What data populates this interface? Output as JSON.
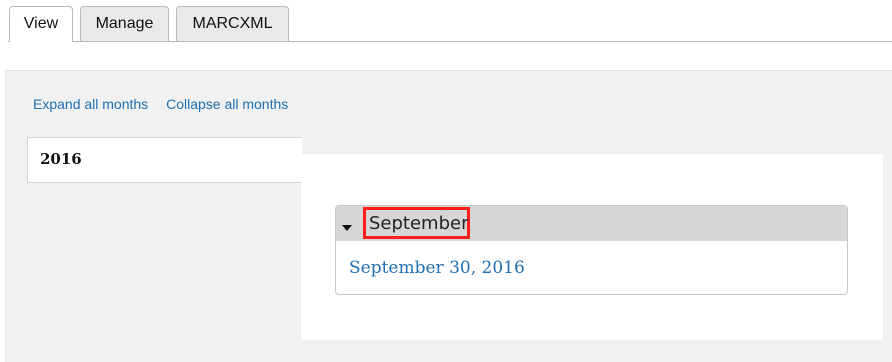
{
  "tabs": [
    {
      "label": "View",
      "active": true
    },
    {
      "label": "Manage",
      "active": false
    },
    {
      "label": "MARCXML",
      "active": false
    }
  ],
  "controls": {
    "expand_all": "Expand all months",
    "collapse_all": "Collapse all months"
  },
  "year": {
    "label": "2016",
    "months": [
      {
        "label": "September",
        "expanded": true,
        "days": [
          "September 30, 2016"
        ]
      }
    ]
  },
  "colors": {
    "link": "#1f6fb2",
    "highlight": "#ff1e1e",
    "panel_bg": "#f1f1f1",
    "month_header_bg": "#d6d6d6"
  }
}
